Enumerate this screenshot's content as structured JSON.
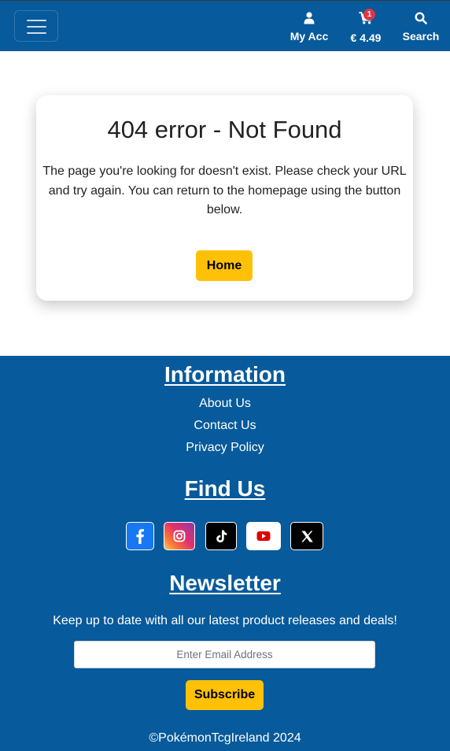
{
  "header": {
    "account_label": "My Acc",
    "cart_label": "€ 4.49",
    "cart_badge": "1",
    "search_label": "Search",
    "menu_icon": "hamburger-icon",
    "account_icon": "user-icon",
    "cart_icon": "shopping-cart-icon",
    "search_icon": "search-icon"
  },
  "error_card": {
    "title": "404 error - Not Found",
    "message": "The page you're looking for doesn't exist. Please check your URL and try again. You can return to the homepage using the button below.",
    "home_button": "Home"
  },
  "footer": {
    "information_heading": "Information",
    "links": [
      "About Us",
      "Contact Us",
      "Privacy Policy"
    ],
    "find_us_heading": "Find Us",
    "socials": [
      {
        "name": "facebook-icon",
        "color": "#1877f2"
      },
      {
        "name": "instagram-icon",
        "color": "#d6249f"
      },
      {
        "name": "tiktok-icon",
        "color": "#000000"
      },
      {
        "name": "youtube-icon",
        "color": "#ffffff"
      },
      {
        "name": "x-icon",
        "color": "#000000"
      }
    ],
    "newsletter_heading": "Newsletter",
    "newsletter_text": "Keep up to date with all our latest product releases and deals!",
    "email_placeholder": "Enter Email Address",
    "subscribe_button": "Subscribe",
    "copyright": "©PokémonTcgIreland 2024"
  },
  "colors": {
    "brand_blue": "#075a9b",
    "accent_yellow": "#ffc107",
    "badge_red": "#dc3545"
  }
}
